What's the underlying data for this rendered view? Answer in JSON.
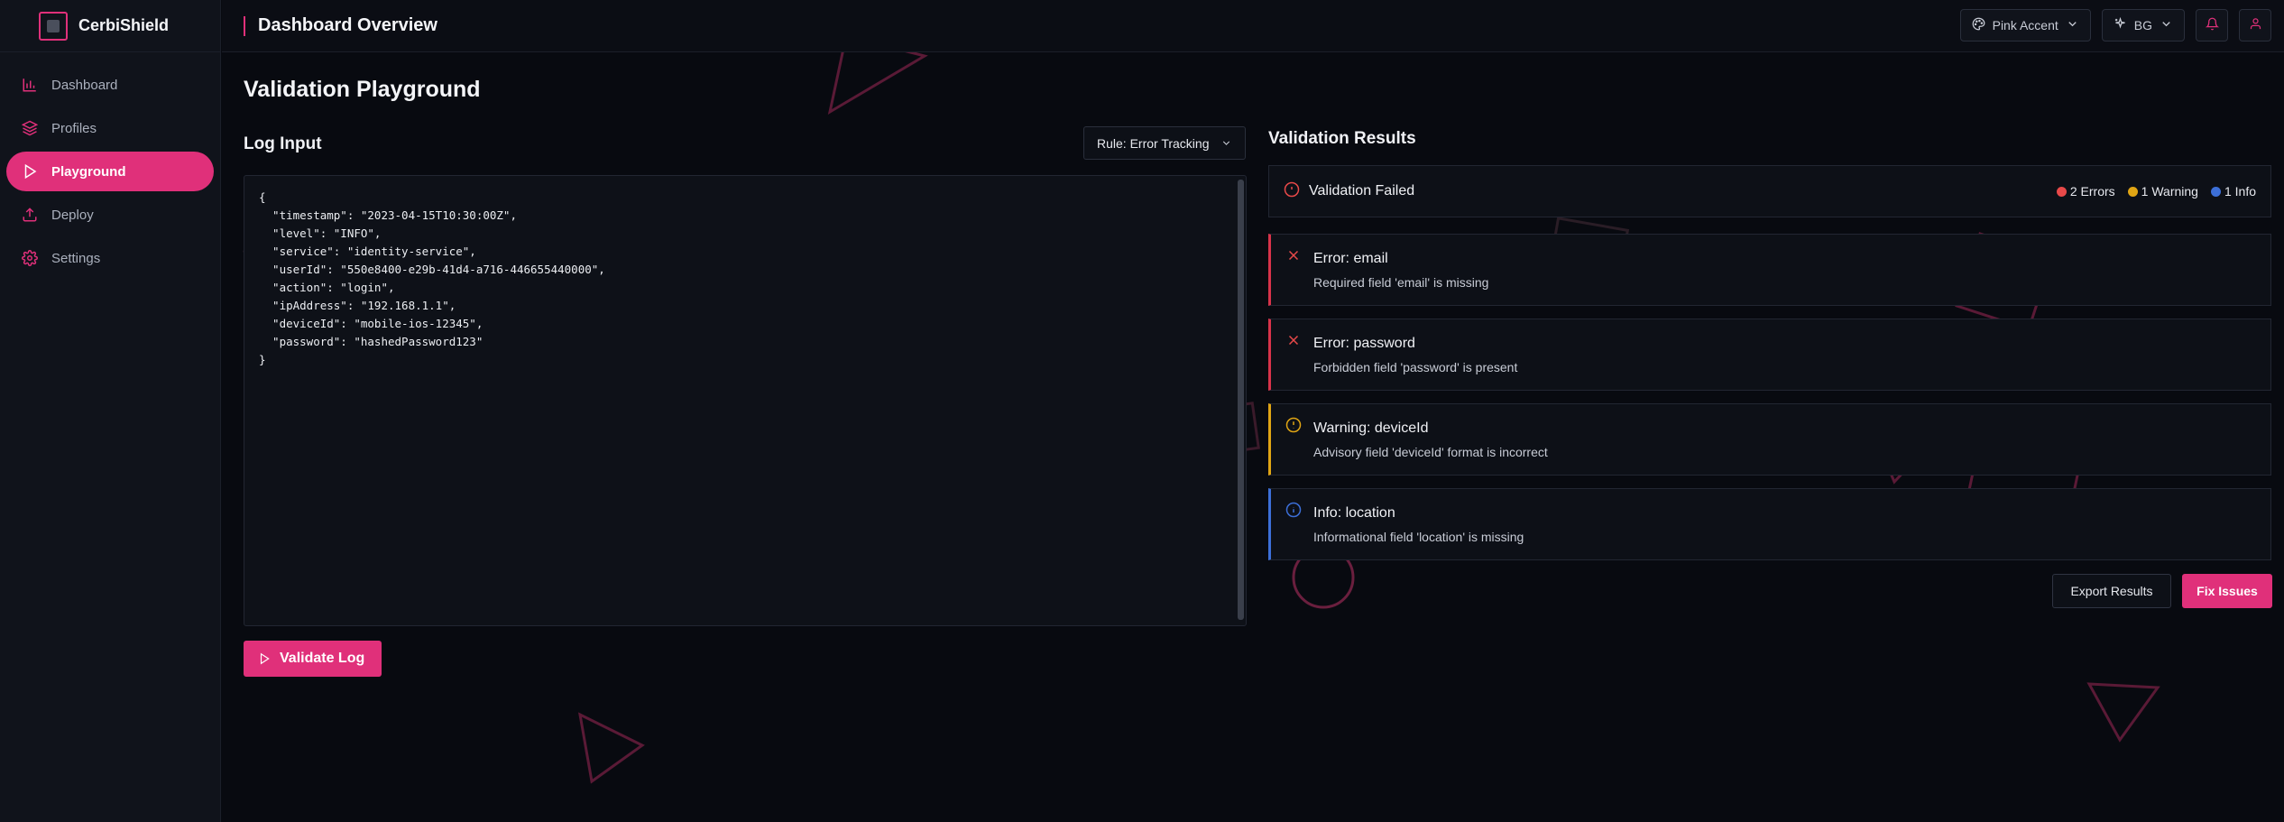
{
  "brand": {
    "name": "CerbiShield"
  },
  "sidebar": {
    "items": [
      {
        "label": "Dashboard",
        "icon": "bar-chart-icon",
        "active": false
      },
      {
        "label": "Profiles",
        "icon": "layers-icon",
        "active": false
      },
      {
        "label": "Playground",
        "icon": "play-icon",
        "active": true
      },
      {
        "label": "Deploy",
        "icon": "upload-icon",
        "active": false
      },
      {
        "label": "Settings",
        "icon": "gear-icon",
        "active": false
      }
    ]
  },
  "header": {
    "title": "Dashboard Overview",
    "theme_label": "Pink Accent",
    "bg_label": "BG"
  },
  "page": {
    "title": "Validation Playground"
  },
  "log_input": {
    "title": "Log Input",
    "rule_select": "Rule: Error Tracking",
    "code": "{\n  \"timestamp\": \"2023-04-15T10:30:00Z\",\n  \"level\": \"INFO\",\n  \"service\": \"identity-service\",\n  \"userId\": \"550e8400-e29b-41d4-a716-446655440000\",\n  \"action\": \"login\",\n  \"ipAddress\": \"192.168.1.1\",\n  \"deviceId\": \"mobile-ios-12345\",\n  \"password\": \"hashedPassword123\"\n}",
    "validate_label": "Validate Log"
  },
  "results": {
    "title": "Validation Results",
    "status": "Validation Failed",
    "counts": {
      "errors": "2 Errors",
      "warnings": "1 Warning",
      "info": "1 Info"
    },
    "items": [
      {
        "type": "error",
        "title": "Error: email",
        "message": "Required field 'email' is missing"
      },
      {
        "type": "error",
        "title": "Error: password",
        "message": "Forbidden field 'password' is present"
      },
      {
        "type": "warning",
        "title": "Warning: deviceId",
        "message": "Advisory field 'deviceId' format is incorrect"
      },
      {
        "type": "info",
        "title": "Info: location",
        "message": "Informational field 'location' is missing"
      }
    ],
    "export_label": "Export Results",
    "fix_label": "Fix Issues"
  },
  "colors": {
    "accent": "#e0307a",
    "error": "#e84949",
    "warning": "#e0a514",
    "info": "#3c6fd8"
  }
}
